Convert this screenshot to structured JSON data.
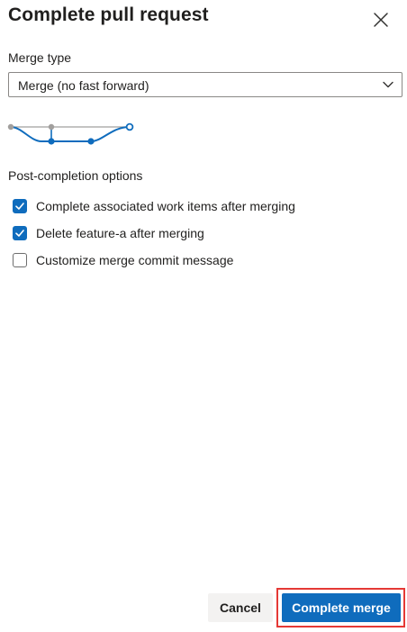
{
  "dialog": {
    "title": "Complete pull request",
    "close_icon": "close-icon"
  },
  "merge_type": {
    "label": "Merge type",
    "selected": "Merge (no fast forward)",
    "chevron_icon": "chevron-down-icon",
    "diagram_icon": "merge-diagram-icon"
  },
  "post_completion": {
    "label": "Post-completion options",
    "options": [
      {
        "label": "Complete associated work items after merging",
        "checked": true
      },
      {
        "label": "Delete feature-a after merging",
        "checked": true
      },
      {
        "label": "Customize merge commit message",
        "checked": false
      }
    ]
  },
  "actions": {
    "cancel_label": "Cancel",
    "complete_label": "Complete merge"
  },
  "colors": {
    "accent": "#0f6cbd",
    "highlight": "#e53935",
    "diagram_gray": "#a19f9d"
  }
}
